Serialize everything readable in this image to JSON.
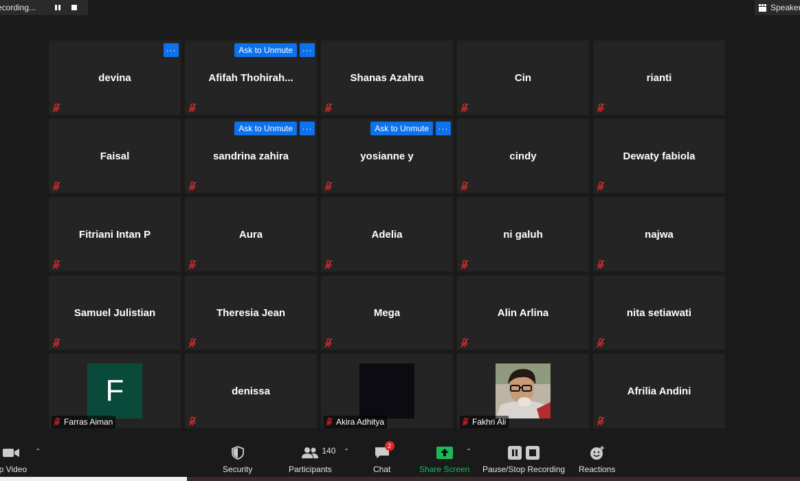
{
  "recording": {
    "label": "ecording..."
  },
  "view": {
    "speaker_label": "Speaker"
  },
  "colors": {
    "tile_bg": "#242424",
    "accent": "#0e72ed",
    "share_green": "#1db954",
    "muted_red": "#e02828"
  },
  "action": {
    "ask_to_unmute": "Ask to Unmute",
    "more": "···"
  },
  "tiles": [
    {
      "name": "devina"
    },
    {
      "name": "Afifah  Thohirah..."
    },
    {
      "name": "Shanas Azahra"
    },
    {
      "name": "Cin"
    },
    {
      "name": "rianti"
    },
    {
      "name": "Faisal"
    },
    {
      "name": "sandrina zahira"
    },
    {
      "name": "yosianne y"
    },
    {
      "name": "cindy"
    },
    {
      "name": "Dewaty fabiola"
    },
    {
      "name": "Fitriani Intan P"
    },
    {
      "name": "Aura"
    },
    {
      "name": "Adelia"
    },
    {
      "name": "ni galuh"
    },
    {
      "name": "najwa"
    },
    {
      "name": "Samuel Julistian"
    },
    {
      "name": "Theresia Jean"
    },
    {
      "name": "Mega"
    },
    {
      "name": "Alin Arlina"
    },
    {
      "name": "nita setiawati"
    },
    {
      "name": "Farras Aiman",
      "avatar_letter": "F"
    },
    {
      "name": "denissa"
    },
    {
      "name": "Akira Adhitya"
    },
    {
      "name": "Fakhri Ali"
    },
    {
      "name": "Afrilia Andini"
    }
  ],
  "toolbar": {
    "video_label": "op Video",
    "security_label": "Security",
    "participants_label": "Participants",
    "participants_count": "140",
    "chat_label": "Chat",
    "chat_badge": "2",
    "share_label": "Share Screen",
    "recording_label": "Pause/Stop Recording",
    "reactions_label": "Reactions"
  }
}
